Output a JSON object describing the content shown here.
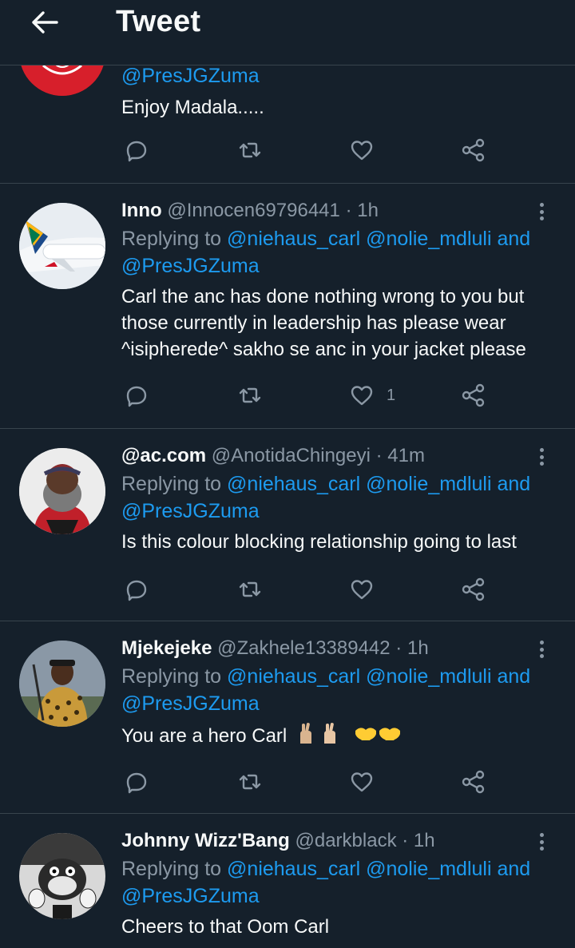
{
  "header": {
    "title": "Tweet"
  },
  "colors": {
    "background": "#15202b",
    "accent": "#1d9bf0",
    "muted": "#8b98a5",
    "divider": "#38444d"
  },
  "partial": {
    "mention": "@PresJGZuma",
    "text": "Enjoy Madala....."
  },
  "tweets": [
    {
      "name": "Inno",
      "handle": "@Innocen69796441",
      "sep": "·",
      "time": "1h",
      "replying_prefix": "Replying to",
      "mention1": "@niehaus_carl",
      "mention2": "@nolie_mdluli",
      "and": "and",
      "mention3": "@PresJGZuma",
      "text": "Carl the anc has done nothing wrong to you but those currently in leadership has please wear ^isipherede^ sakho se anc in your jacket please",
      "like_count": "1"
    },
    {
      "name": "@ac.com",
      "handle": "@AnotidaChingeyi",
      "sep": "·",
      "time": "41m",
      "replying_prefix": "Replying to",
      "mention1": "@niehaus_carl",
      "mention2": "@nolie_mdluli",
      "and": "and",
      "mention3": "@PresJGZuma",
      "text": "Is this colour blocking relationship going to last",
      "like_count": ""
    },
    {
      "name": "Mjekejeke",
      "handle": "@Zakhele13389442",
      "sep": "·",
      "time": "1h",
      "replying_prefix": "Replying to",
      "mention1": "@niehaus_carl",
      "mention2": "@nolie_mdluli",
      "and": "and",
      "mention3": "@PresJGZuma",
      "text": "You are a hero Carl",
      "like_count": ""
    },
    {
      "name": "Johnny Wizz'Bang",
      "handle": "@darkblack",
      "sep": "·",
      "time": "1h",
      "replying_prefix": "Replying to",
      "mention1": "@niehaus_carl",
      "mention2": "@nolie_mdluli",
      "and": "and",
      "mention3": "@PresJGZuma",
      "text": "Cheers to that Oom Carl"
    }
  ]
}
